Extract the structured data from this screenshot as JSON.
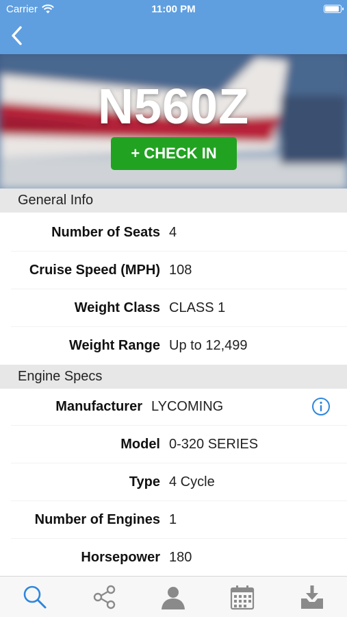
{
  "status_bar": {
    "carrier": "Carrier",
    "time": "11:00 PM",
    "battery_level": 1.0
  },
  "nav": {
    "back_icon": "chevron-left-icon"
  },
  "hero": {
    "tail_number": "N560Z",
    "checkin_label": "+ CHECK IN"
  },
  "general_info": {
    "header": "General Info",
    "rows": [
      {
        "label": "Number of Seats",
        "value": "4"
      },
      {
        "label": "Cruise Speed (MPH)",
        "value": "108"
      },
      {
        "label": "Weight Class",
        "value": "CLASS 1"
      },
      {
        "label": "Weight Range",
        "value": "Up to 12,499"
      }
    ]
  },
  "engine_specs": {
    "header": "Engine Specs",
    "rows": [
      {
        "label": "Manufacturer",
        "value": "LYCOMING"
      },
      {
        "label": "Model",
        "value": "0-320 SERIES"
      },
      {
        "label": "Type",
        "value": "4 Cycle"
      },
      {
        "label": "Number of Engines",
        "value": "1"
      },
      {
        "label": "Horsepower",
        "value": "180"
      }
    ]
  },
  "tab_bar": {
    "tabs": [
      "search-icon",
      "share-icon",
      "profile-icon",
      "calendar-icon",
      "download-icon"
    ],
    "active": "search-icon"
  },
  "colors": {
    "nav_blue": "#5f9fe0",
    "checkin_green": "#21a321",
    "accent_blue": "#2e86de",
    "tab_inactive": "#8a8a8a"
  }
}
